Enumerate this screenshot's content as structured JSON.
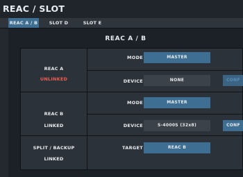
{
  "window": {
    "title": "REAC / SLOT"
  },
  "tabs": [
    {
      "label": "REAC A / B",
      "active": true
    },
    {
      "label": "SLOT D",
      "active": false
    },
    {
      "label": "SLOT E",
      "active": false
    }
  ],
  "main": {
    "section_title": "REAC A / B",
    "reac_a": {
      "name": "REAC A",
      "status": "UNLINKED",
      "mode_label": "MODE",
      "mode_value": "MASTER",
      "device_label": "DEVICE",
      "device_value": "NONE",
      "config_label": "CONF"
    },
    "reac_b": {
      "name": "REAC B",
      "status": "LINKED",
      "mode_label": "MODE",
      "mode_value": "MASTER",
      "device_label": "DEVICE",
      "device_value": "S-4000S (32x8)",
      "config_label": "CONF"
    },
    "split_backup": {
      "name": "SPLIT / BACKUP",
      "status": "LINKED",
      "target_label": "TARGET",
      "target_value": "REAC B"
    }
  },
  "colors": {
    "accent": "#3e6f93",
    "unlinked": "#ee5d52",
    "background": "#1c2127",
    "panel": "#2b3239"
  }
}
